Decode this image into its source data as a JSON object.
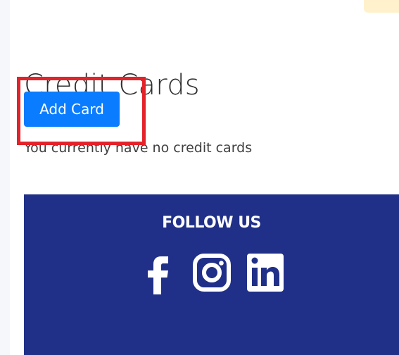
{
  "page": {
    "title": "Credit Cards",
    "add_card_label": "Add Card",
    "empty_message": "You currently have no credit cards"
  },
  "footer": {
    "follow_label": "FOLLOW US",
    "social": [
      {
        "name": "facebook",
        "icon": "facebook-icon"
      },
      {
        "name": "instagram",
        "icon": "instagram-icon"
      },
      {
        "name": "linkedin",
        "icon": "linkedin-icon"
      }
    ]
  },
  "colors": {
    "primary_button": "#0a7cff",
    "footer_background": "#203088",
    "highlight_outline": "#e3222a",
    "title_text": "#2f2f2f"
  }
}
